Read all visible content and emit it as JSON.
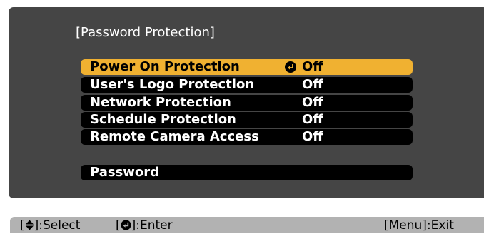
{
  "dialog": {
    "title": "[Password Protection]",
    "items": [
      {
        "label": "Power On Protection",
        "value": "Off",
        "selected": true
      },
      {
        "label": "User's Logo Protection",
        "value": "Off"
      },
      {
        "label": "Network Protection",
        "value": "Off"
      },
      {
        "label": "Schedule Protection",
        "value": "Off"
      },
      {
        "label": "Remote Camera Access",
        "value": "Off"
      }
    ],
    "password_label": "Password"
  },
  "footer": {
    "select_open": "[",
    "select_close": "]:Select",
    "enter_open": "[",
    "enter_close": "]:Enter",
    "exit_label": "[Menu]:Exit",
    "select_icon": "up-down-arrow-icon",
    "enter_icon": "enter-icon"
  },
  "colors": {
    "panel_bg": "#454545",
    "selection": "#f0b131",
    "row_bg": "#000000",
    "footer_bg": "#b2b2b2"
  }
}
